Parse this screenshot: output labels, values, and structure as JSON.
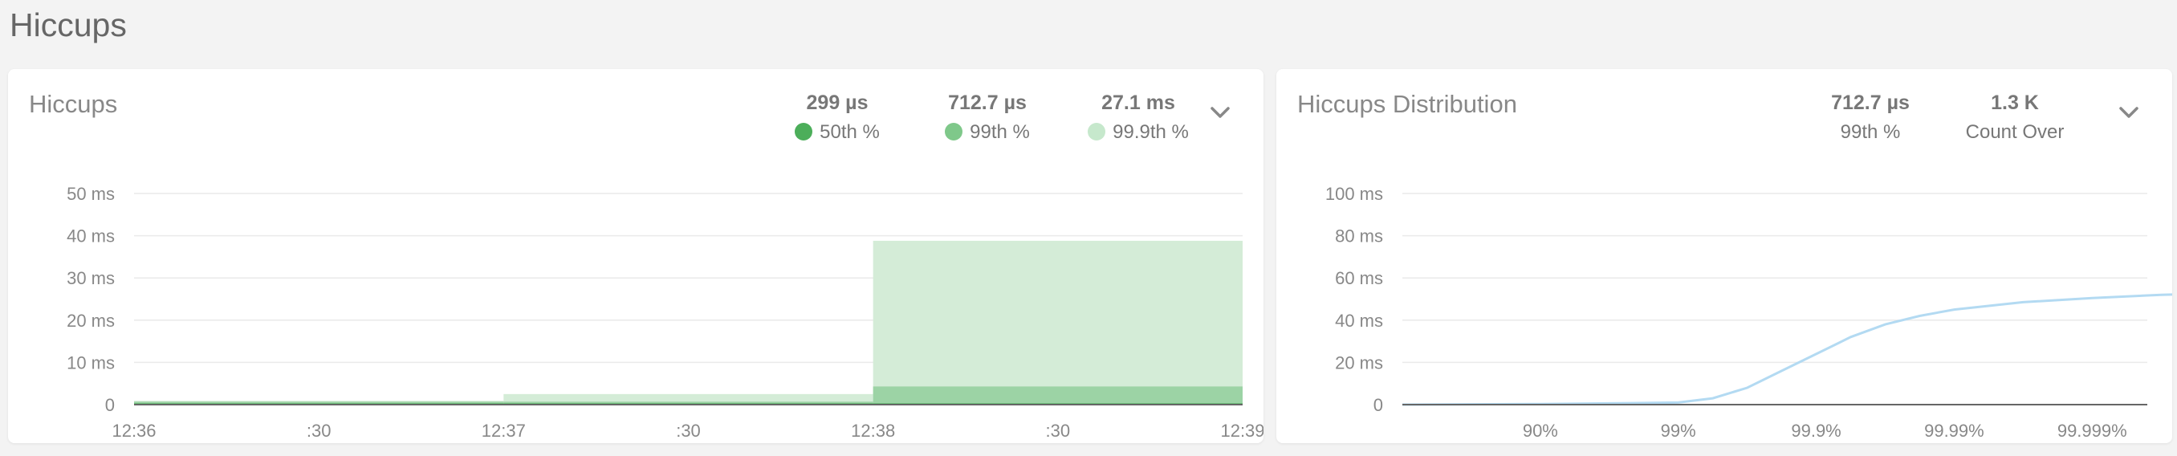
{
  "page": {
    "title": "Hiccups"
  },
  "left_panel": {
    "title": "Hiccups",
    "stats": [
      {
        "value": "299 µs",
        "label": "50th %",
        "color": "#4cae5a"
      },
      {
        "value": "712.7 µs",
        "label": "99th %",
        "color": "#7fc88a"
      },
      {
        "value": "27.1 ms",
        "label": "99.9th %",
        "color": "#c6e8cc"
      }
    ]
  },
  "right_panel": {
    "title": "Hiccups Distribution",
    "stats": [
      {
        "value": "712.7 µs",
        "label": "99th %"
      },
      {
        "value": "1.3 K",
        "label": "Count Over"
      }
    ]
  },
  "chart_data": [
    {
      "type": "area",
      "title": "Hiccups",
      "y_tick_labels": [
        "0",
        "10 ms",
        "20 ms",
        "30 ms",
        "40 ms",
        "50 ms"
      ],
      "ylim": [
        0,
        50
      ],
      "x_tick_labels": [
        "12:36",
        ":30",
        "12:37",
        ":30",
        "12:38",
        ":30",
        "12:39"
      ],
      "grid": true,
      "series": [
        {
          "name": "99.9th %",
          "color": "#d4ecd7",
          "segments": [
            {
              "from": 0,
              "to": 2,
              "value": 0.9
            },
            {
              "from": 2,
              "to": 4,
              "value": 2.5
            },
            {
              "from": 4,
              "to": 6,
              "value": 38.8
            }
          ]
        },
        {
          "name": "99th %",
          "color": "#9cd3a5",
          "segments": [
            {
              "from": 0,
              "to": 2,
              "value": 0.7
            },
            {
              "from": 2,
              "to": 4,
              "value": 0.7
            },
            {
              "from": 4,
              "to": 6,
              "value": 4.3
            }
          ]
        },
        {
          "name": "50th %",
          "color": "#4cae5a",
          "segments": [
            {
              "from": 0,
              "to": 2,
              "value": 0.3
            },
            {
              "from": 2,
              "to": 4,
              "value": 0.3
            },
            {
              "from": 4,
              "to": 6,
              "value": 0.3
            }
          ]
        }
      ]
    },
    {
      "type": "line",
      "title": "Hiccups Distribution",
      "y_tick_labels": [
        "0",
        "20 ms",
        "40 ms",
        "60 ms",
        "80 ms",
        "100 ms"
      ],
      "ylim": [
        0,
        100
      ],
      "x_tick_labels": [
        "90%",
        "99%",
        "99.9%",
        "99.99%",
        "99.999%"
      ],
      "x_scale": "log-percentile",
      "grid": true,
      "series": [
        {
          "name": "",
          "color": "#b3daf2",
          "points": [
            [
              0,
              0
            ],
            [
              1,
              0.3
            ],
            [
              1.5,
              0.6
            ],
            [
              2,
              1
            ],
            [
              2.25,
              3
            ],
            [
              2.5,
              8
            ],
            [
              2.75,
              16
            ],
            [
              3,
              24
            ],
            [
              3.25,
              32
            ],
            [
              3.5,
              38
            ],
            [
              3.75,
              42
            ],
            [
              4,
              45
            ],
            [
              4.5,
              48.5
            ],
            [
              5,
              50.5
            ],
            [
              5.5,
              52
            ],
            [
              5.8,
              52.5
            ]
          ]
        }
      ]
    }
  ]
}
